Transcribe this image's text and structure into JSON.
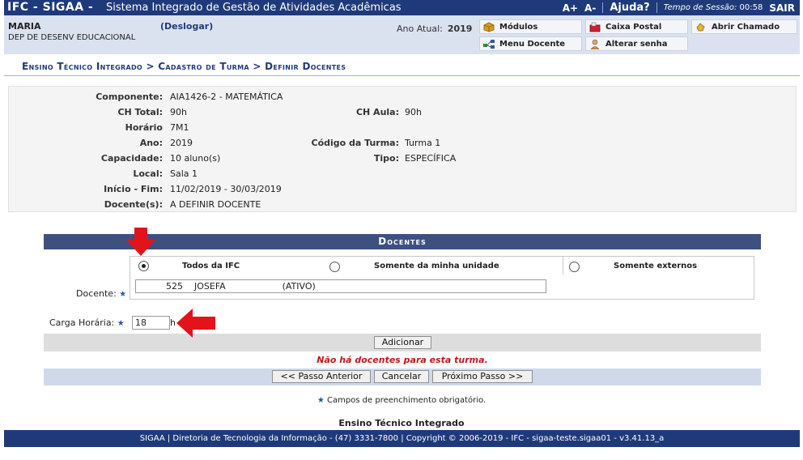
{
  "topbar": {
    "brand": "IFC - SIGAA -",
    "system_name": "Sistema Integrado de Gestão de Atividades Acadêmicas",
    "font_increase": "A+",
    "font_decrease": "A-",
    "help": "Ajuda?",
    "session_label": "Tempo de Sessão:",
    "session_time": "00:58",
    "logout": "SAIR"
  },
  "user": {
    "name": "MARIA",
    "logout_link": "(Deslogar)",
    "unit": "DEP DE DESENV EDUCACIONAL",
    "year_label": "Ano Atual:",
    "year_value": "2019"
  },
  "menu_buttons": {
    "modulos": "Módulos",
    "caixa_postal": "Caixa Postal",
    "abrir_chamado": "Abrir Chamado",
    "menu_docente": "Menu Docente",
    "alterar_senha": "Alterar senha"
  },
  "breadcrumb": "Ensino Técnico Integrado > Cadastro de Turma > Definir Docentes",
  "details": {
    "componente_label": "Componente:",
    "componente": "AIA1426-2 - MATEMÁTICA",
    "ch_total_label": "CH Total:",
    "ch_total": "90h",
    "ch_aula_label": "CH Aula:",
    "ch_aula": "90h",
    "horario_label": "Horário",
    "horario": "7M1",
    "ano_label": "Ano:",
    "ano": "2019",
    "codigo_label": "Código da Turma:",
    "codigo": "Turma 1",
    "capacidade_label": "Capacidade:",
    "capacidade": "10 aluno(s)",
    "tipo_label": "Tipo:",
    "tipo": "ESPECÍFICA",
    "local_label": "Local:",
    "local": "Sala 1",
    "inicio_fim_label": "Início - Fim:",
    "inicio_fim": "11/02/2019 - 30/03/2019",
    "docentes_label": "Docente(s):",
    "docentes": "A DEFINIR DOCENTE"
  },
  "docentes_panel": {
    "title": "Docentes",
    "docente_label": "Docente:",
    "radio_todos": "Todos da IFC",
    "radio_unidade": "Somente da minha unidade",
    "radio_externos": "Somente externos",
    "docente_value": "525    JOSEFA                    (ATIVO)",
    "carga_label": "Carga Horária:",
    "carga_value": "18",
    "carga_unit": "h",
    "add_button": "Adicionar",
    "empty_message": "Não há docentes para esta turma.",
    "prev_button": "<< Passo Anterior",
    "cancel_button": "Cancelar",
    "next_button": "Próximo Passo >>"
  },
  "required_note": "Campos de preenchimento obrigatório.",
  "footer_title": "Ensino Técnico Integrado",
  "footer": "SIGAA | Diretoria de Tecnologia da Informação - (47) 3331-7800 | Copyright © 2006-2019 - IFC - sigaa-teste.sigaa01 - v3.41.13_a",
  "colors": {
    "header_blue": "#1f3a7a",
    "panel_header": "#3d5080",
    "arrow_red": "#e3131b",
    "error_red": "#c01818"
  }
}
